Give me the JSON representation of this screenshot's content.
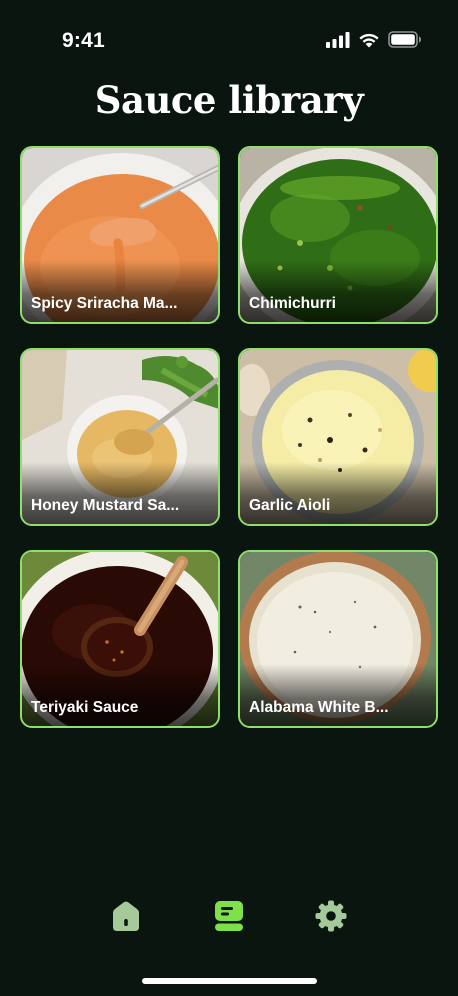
{
  "status_bar": {
    "time": "9:41",
    "icons": [
      "cellular-signal-icon",
      "wifi-icon",
      "battery-icon"
    ]
  },
  "header": {
    "title": "Sauce library"
  },
  "sauces": [
    {
      "name": "Spicy Sriracha Ma...",
      "image": "sriracha-mayo-photo"
    },
    {
      "name": "Chimichurri",
      "image": "chimichurri-photo"
    },
    {
      "name": "Honey Mustard Sa...",
      "image": "honey-mustard-photo"
    },
    {
      "name": "Garlic Aioli",
      "image": "garlic-aioli-photo"
    },
    {
      "name": "Teriyaki Sauce",
      "image": "teriyaki-photo"
    },
    {
      "name": "Alabama White B...",
      "image": "alabama-white-bbq-photo"
    }
  ],
  "tab_bar": {
    "tabs": [
      {
        "icon": "home-icon",
        "active": false
      },
      {
        "icon": "library-icon",
        "active": true
      },
      {
        "icon": "gear-icon",
        "active": false
      }
    ]
  },
  "colors": {
    "background": "#0a1510",
    "accent": "#8fe06a",
    "inactive_icon": "#a6c99a",
    "active_icon": "#7ee04a"
  }
}
